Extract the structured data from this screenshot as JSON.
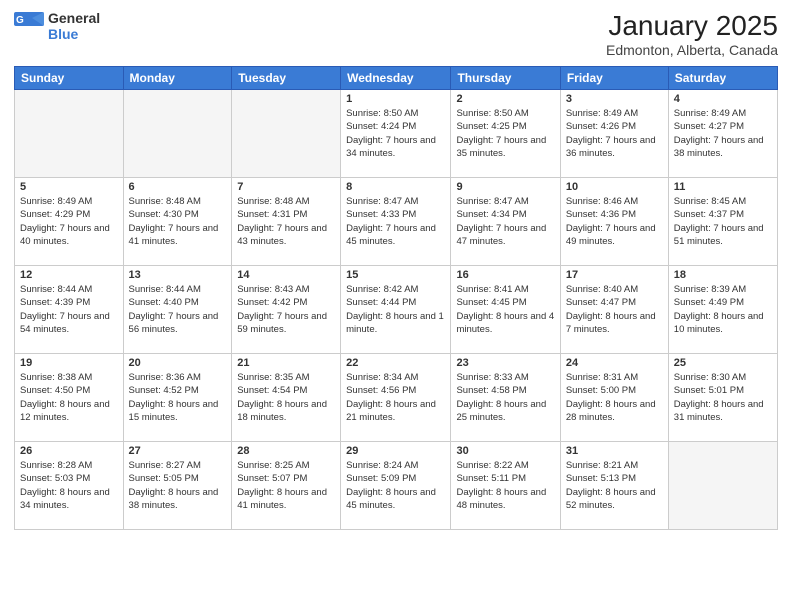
{
  "header": {
    "logo_general": "General",
    "logo_blue": "Blue",
    "month_title": "January 2025",
    "location": "Edmonton, Alberta, Canada"
  },
  "weekdays": [
    "Sunday",
    "Monday",
    "Tuesday",
    "Wednesday",
    "Thursday",
    "Friday",
    "Saturday"
  ],
  "weeks": [
    [
      {
        "day": "",
        "sunrise": "",
        "sunset": "",
        "daylight": ""
      },
      {
        "day": "",
        "sunrise": "",
        "sunset": "",
        "daylight": ""
      },
      {
        "day": "",
        "sunrise": "",
        "sunset": "",
        "daylight": ""
      },
      {
        "day": "1",
        "sunrise": "Sunrise: 8:50 AM",
        "sunset": "Sunset: 4:24 PM",
        "daylight": "Daylight: 7 hours and 34 minutes."
      },
      {
        "day": "2",
        "sunrise": "Sunrise: 8:50 AM",
        "sunset": "Sunset: 4:25 PM",
        "daylight": "Daylight: 7 hours and 35 minutes."
      },
      {
        "day": "3",
        "sunrise": "Sunrise: 8:49 AM",
        "sunset": "Sunset: 4:26 PM",
        "daylight": "Daylight: 7 hours and 36 minutes."
      },
      {
        "day": "4",
        "sunrise": "Sunrise: 8:49 AM",
        "sunset": "Sunset: 4:27 PM",
        "daylight": "Daylight: 7 hours and 38 minutes."
      }
    ],
    [
      {
        "day": "5",
        "sunrise": "Sunrise: 8:49 AM",
        "sunset": "Sunset: 4:29 PM",
        "daylight": "Daylight: 7 hours and 40 minutes."
      },
      {
        "day": "6",
        "sunrise": "Sunrise: 8:48 AM",
        "sunset": "Sunset: 4:30 PM",
        "daylight": "Daylight: 7 hours and 41 minutes."
      },
      {
        "day": "7",
        "sunrise": "Sunrise: 8:48 AM",
        "sunset": "Sunset: 4:31 PM",
        "daylight": "Daylight: 7 hours and 43 minutes."
      },
      {
        "day": "8",
        "sunrise": "Sunrise: 8:47 AM",
        "sunset": "Sunset: 4:33 PM",
        "daylight": "Daylight: 7 hours and 45 minutes."
      },
      {
        "day": "9",
        "sunrise": "Sunrise: 8:47 AM",
        "sunset": "Sunset: 4:34 PM",
        "daylight": "Daylight: 7 hours and 47 minutes."
      },
      {
        "day": "10",
        "sunrise": "Sunrise: 8:46 AM",
        "sunset": "Sunset: 4:36 PM",
        "daylight": "Daylight: 7 hours and 49 minutes."
      },
      {
        "day": "11",
        "sunrise": "Sunrise: 8:45 AM",
        "sunset": "Sunset: 4:37 PM",
        "daylight": "Daylight: 7 hours and 51 minutes."
      }
    ],
    [
      {
        "day": "12",
        "sunrise": "Sunrise: 8:44 AM",
        "sunset": "Sunset: 4:39 PM",
        "daylight": "Daylight: 7 hours and 54 minutes."
      },
      {
        "day": "13",
        "sunrise": "Sunrise: 8:44 AM",
        "sunset": "Sunset: 4:40 PM",
        "daylight": "Daylight: 7 hours and 56 minutes."
      },
      {
        "day": "14",
        "sunrise": "Sunrise: 8:43 AM",
        "sunset": "Sunset: 4:42 PM",
        "daylight": "Daylight: 7 hours and 59 minutes."
      },
      {
        "day": "15",
        "sunrise": "Sunrise: 8:42 AM",
        "sunset": "Sunset: 4:44 PM",
        "daylight": "Daylight: 8 hours and 1 minute."
      },
      {
        "day": "16",
        "sunrise": "Sunrise: 8:41 AM",
        "sunset": "Sunset: 4:45 PM",
        "daylight": "Daylight: 8 hours and 4 minutes."
      },
      {
        "day": "17",
        "sunrise": "Sunrise: 8:40 AM",
        "sunset": "Sunset: 4:47 PM",
        "daylight": "Daylight: 8 hours and 7 minutes."
      },
      {
        "day": "18",
        "sunrise": "Sunrise: 8:39 AM",
        "sunset": "Sunset: 4:49 PM",
        "daylight": "Daylight: 8 hours and 10 minutes."
      }
    ],
    [
      {
        "day": "19",
        "sunrise": "Sunrise: 8:38 AM",
        "sunset": "Sunset: 4:50 PM",
        "daylight": "Daylight: 8 hours and 12 minutes."
      },
      {
        "day": "20",
        "sunrise": "Sunrise: 8:36 AM",
        "sunset": "Sunset: 4:52 PM",
        "daylight": "Daylight: 8 hours and 15 minutes."
      },
      {
        "day": "21",
        "sunrise": "Sunrise: 8:35 AM",
        "sunset": "Sunset: 4:54 PM",
        "daylight": "Daylight: 8 hours and 18 minutes."
      },
      {
        "day": "22",
        "sunrise": "Sunrise: 8:34 AM",
        "sunset": "Sunset: 4:56 PM",
        "daylight": "Daylight: 8 hours and 21 minutes."
      },
      {
        "day": "23",
        "sunrise": "Sunrise: 8:33 AM",
        "sunset": "Sunset: 4:58 PM",
        "daylight": "Daylight: 8 hours and 25 minutes."
      },
      {
        "day": "24",
        "sunrise": "Sunrise: 8:31 AM",
        "sunset": "Sunset: 5:00 PM",
        "daylight": "Daylight: 8 hours and 28 minutes."
      },
      {
        "day": "25",
        "sunrise": "Sunrise: 8:30 AM",
        "sunset": "Sunset: 5:01 PM",
        "daylight": "Daylight: 8 hours and 31 minutes."
      }
    ],
    [
      {
        "day": "26",
        "sunrise": "Sunrise: 8:28 AM",
        "sunset": "Sunset: 5:03 PM",
        "daylight": "Daylight: 8 hours and 34 minutes."
      },
      {
        "day": "27",
        "sunrise": "Sunrise: 8:27 AM",
        "sunset": "Sunset: 5:05 PM",
        "daylight": "Daylight: 8 hours and 38 minutes."
      },
      {
        "day": "28",
        "sunrise": "Sunrise: 8:25 AM",
        "sunset": "Sunset: 5:07 PM",
        "daylight": "Daylight: 8 hours and 41 minutes."
      },
      {
        "day": "29",
        "sunrise": "Sunrise: 8:24 AM",
        "sunset": "Sunset: 5:09 PM",
        "daylight": "Daylight: 8 hours and 45 minutes."
      },
      {
        "day": "30",
        "sunrise": "Sunrise: 8:22 AM",
        "sunset": "Sunset: 5:11 PM",
        "daylight": "Daylight: 8 hours and 48 minutes."
      },
      {
        "day": "31",
        "sunrise": "Sunrise: 8:21 AM",
        "sunset": "Sunset: 5:13 PM",
        "daylight": "Daylight: 8 hours and 52 minutes."
      },
      {
        "day": "",
        "sunrise": "",
        "sunset": "",
        "daylight": ""
      }
    ]
  ]
}
